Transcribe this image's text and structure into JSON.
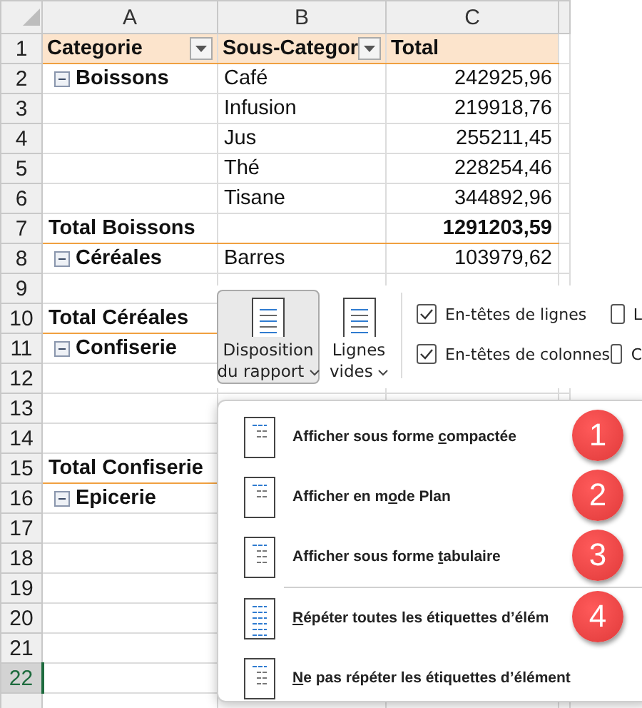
{
  "columns": [
    "A",
    "B",
    "C"
  ],
  "header": {
    "number": "1",
    "cells": [
      {
        "text": "Categorie",
        "filter": true
      },
      {
        "text": "Sous-Categor",
        "filter": true
      },
      {
        "text": "Total"
      }
    ]
  },
  "rows": [
    {
      "number": "2",
      "kind": "detail",
      "category": "Boissons",
      "collapsible": true,
      "subcategory": "Café",
      "total": "242925,96",
      "selected": false
    },
    {
      "number": "3",
      "kind": "detail",
      "subcategory": "Infusion",
      "total": "219918,76",
      "selected": false
    },
    {
      "number": "4",
      "kind": "detail",
      "subcategory": "Jus",
      "total": "255211,45",
      "selected": false
    },
    {
      "number": "5",
      "kind": "detail",
      "subcategory": "Thé",
      "total": "228254,46",
      "selected": false
    },
    {
      "number": "6",
      "kind": "detail",
      "subcategory": "Tisane",
      "total": "344892,96",
      "selected": false
    },
    {
      "number": "7",
      "kind": "total",
      "category": "Total Boissons",
      "total": "1291203,59",
      "selected": false
    },
    {
      "number": "8",
      "kind": "detail",
      "category": "Céréales",
      "collapsible": true,
      "subcategory": "Barres",
      "total": "103979,62",
      "selected": false
    },
    {
      "number": "9",
      "kind": "detail",
      "selected": false
    },
    {
      "number": "10",
      "kind": "total",
      "category": "Total Céréales",
      "selected": false
    },
    {
      "number": "11",
      "kind": "detail",
      "category": "Confiserie",
      "collapsible": true,
      "selected": false
    },
    {
      "number": "12",
      "kind": "detail",
      "selected": false
    },
    {
      "number": "13",
      "kind": "detail",
      "selected": false
    },
    {
      "number": "14",
      "kind": "detail",
      "selected": false
    },
    {
      "number": "15",
      "kind": "total",
      "category": "Total Confiserie",
      "selected": false
    },
    {
      "number": "16",
      "kind": "detail",
      "category": "Epicerie",
      "collapsible": true,
      "selected": false
    },
    {
      "number": "17",
      "kind": "detail",
      "selected": false
    },
    {
      "number": "18",
      "kind": "detail",
      "selected": false
    },
    {
      "number": "19",
      "kind": "detail",
      "selected": false
    },
    {
      "number": "20",
      "kind": "detail",
      "selected": false
    },
    {
      "number": "21",
      "kind": "detail",
      "selected": false
    },
    {
      "number": "22",
      "kind": "detail",
      "selected": true
    }
  ],
  "ribbon": {
    "buttons": [
      {
        "lines": [
          "Disposition",
          "du rapport"
        ],
        "selected": true
      },
      {
        "lines": [
          "Lignes",
          "vides"
        ],
        "selected": false
      }
    ],
    "checkboxes": [
      {
        "label": "En-têtes de lignes",
        "checked": true
      },
      {
        "label": "L",
        "checked": false
      },
      {
        "label": "En-têtes de colonnes",
        "checked": true
      },
      {
        "label": "C",
        "checked": false
      }
    ]
  },
  "menu": {
    "items": [
      {
        "before": "Afficher sous forme ",
        "key": "c",
        "after": "ompactée",
        "badge": "1",
        "separator_before": false
      },
      {
        "before": "Afficher en m",
        "key": "o",
        "after": "de Plan",
        "badge": "2",
        "separator_before": false
      },
      {
        "before": "Afficher sous forme ",
        "key": "t",
        "after": "abulaire",
        "badge": "3",
        "separator_before": false
      },
      {
        "key": "R",
        "after": "épéter toutes les étiquettes d’élém",
        "badge": "4",
        "separator_before": true
      },
      {
        "key": "N",
        "after": "e pas répéter les étiquettes d’élément",
        "separator_before": false
      }
    ]
  }
}
